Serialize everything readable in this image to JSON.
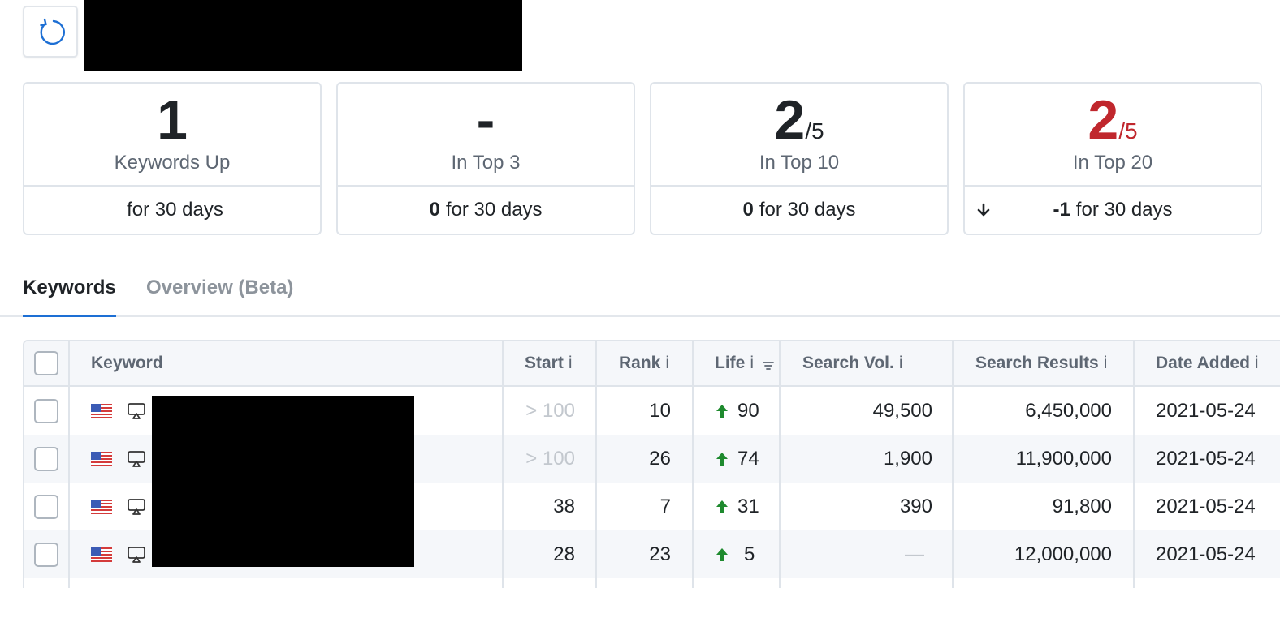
{
  "cards": [
    {
      "value": "1",
      "fraction": "",
      "label": "Keywords Up",
      "delta": "",
      "period": "for 30 days"
    },
    {
      "value": "-",
      "fraction": "",
      "label": "In Top 3",
      "delta": "0",
      "period": "for 30 days"
    },
    {
      "value": "2",
      "fraction": "/5",
      "label": "In Top 10",
      "delta": "0",
      "period": "for 30 days"
    },
    {
      "value": "2",
      "fraction": "/5",
      "label": "In Top 20",
      "delta": "-1",
      "period": "for 30 days"
    }
  ],
  "tabs": {
    "keywords": "Keywords",
    "overview": "Overview (Beta)"
  },
  "table": {
    "headers": {
      "keyword": "Keyword",
      "start": "Start",
      "rank": "Rank",
      "life": "Life",
      "search_vol": "Search Vol.",
      "search_results": "Search Results",
      "date_added": "Date Added",
      "info": "i"
    },
    "rows": [
      {
        "start": "> 100",
        "rank": "10",
        "life": "90",
        "search_vol": "49,500",
        "search_results": "6,450,000",
        "date_added": "2021-05-24"
      },
      {
        "start": "> 100",
        "rank": "26",
        "life": "74",
        "search_vol": "1,900",
        "search_results": "11,900,000",
        "date_added": "2021-05-24"
      },
      {
        "start": "38",
        "rank": "7",
        "life": "31",
        "search_vol": "390",
        "search_results": "91,800",
        "date_added": "2021-05-24"
      },
      {
        "start": "28",
        "rank": "23",
        "life": "5",
        "search_vol": "—",
        "search_results": "12,000,000",
        "date_added": "2021-05-24"
      }
    ]
  },
  "colors": {
    "accent": "#1d6fd4",
    "negative": "#c0272d",
    "positive": "#1e8a2e"
  },
  "icons": {
    "refresh": "refresh-icon",
    "down": "arrow-down-icon",
    "up": "arrow-up-icon",
    "flag": "us-flag-icon",
    "device": "desktop-icon",
    "sort": "sort-icon"
  }
}
